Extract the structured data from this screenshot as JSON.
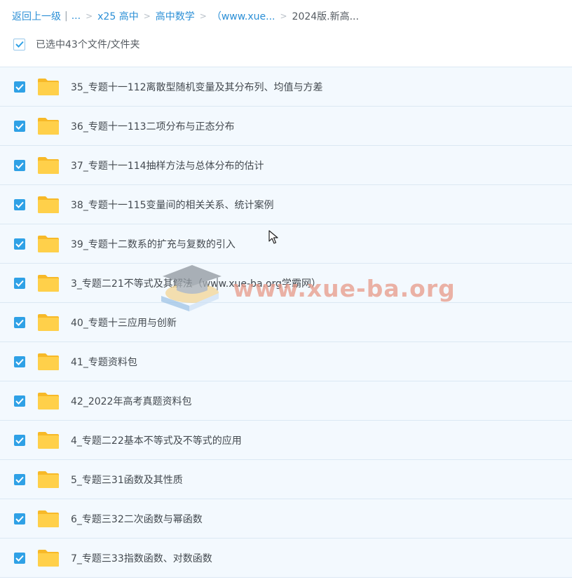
{
  "breadcrumb": {
    "back_label": "返回上一级",
    "divider": "|",
    "ellipsis": "...",
    "separator": ">",
    "items": [
      {
        "label": "x25 高中"
      },
      {
        "label": "高中数学"
      },
      {
        "label": "（www.xue..."
      }
    ],
    "current": "2024版.新高..."
  },
  "selection": {
    "label": "已选中43个文件/文件夹",
    "checked": true
  },
  "files": [
    {
      "name": "35_专题十一112离散型随机变量及其分布列、均值与方差",
      "type": "folder",
      "checked": true
    },
    {
      "name": "36_专题十一113二项分布与正态分布",
      "type": "folder",
      "checked": true
    },
    {
      "name": "37_专题十一114抽样方法与总体分布的估计",
      "type": "folder",
      "checked": true
    },
    {
      "name": "38_专题十一115变量间的相关关系、统计案例",
      "type": "folder",
      "checked": true
    },
    {
      "name": "39_专题十二数系的扩充与复数的引入",
      "type": "folder",
      "checked": true
    },
    {
      "name": "3_专题二21不等式及其解法（www.xue-ba.org学霸网）",
      "type": "folder",
      "checked": true
    },
    {
      "name": "40_专题十三应用与创新",
      "type": "folder",
      "checked": true
    },
    {
      "name": "41_专题资料包",
      "type": "folder",
      "checked": true
    },
    {
      "name": "42_2022年高考真题资料包",
      "type": "folder",
      "checked": true
    },
    {
      "name": "4_专题二22基本不等式及不等式的应用",
      "type": "folder",
      "checked": true
    },
    {
      "name": "5_专题三31函数及其性质",
      "type": "folder",
      "checked": true
    },
    {
      "name": "6_专题三32二次函数与幂函数",
      "type": "folder",
      "checked": true
    },
    {
      "name": "7_专题三33指数函数、对数函数",
      "type": "folder",
      "checked": true
    }
  ],
  "watermark": {
    "text": "www.xue-ba.org",
    "icon": "graduation-cap-book-logo"
  },
  "icons": {
    "folder": "folder-icon",
    "checkbox": "checkbox-checked-icon",
    "cursor": "mouse-pointer-icon"
  },
  "colors": {
    "accent": "#2fa1e6",
    "link": "#2b8fd6",
    "row_bg": "#f3f9fe",
    "row_border": "#dbe8f3",
    "folder": "#ffce3d",
    "watermark": "#e89a88"
  }
}
